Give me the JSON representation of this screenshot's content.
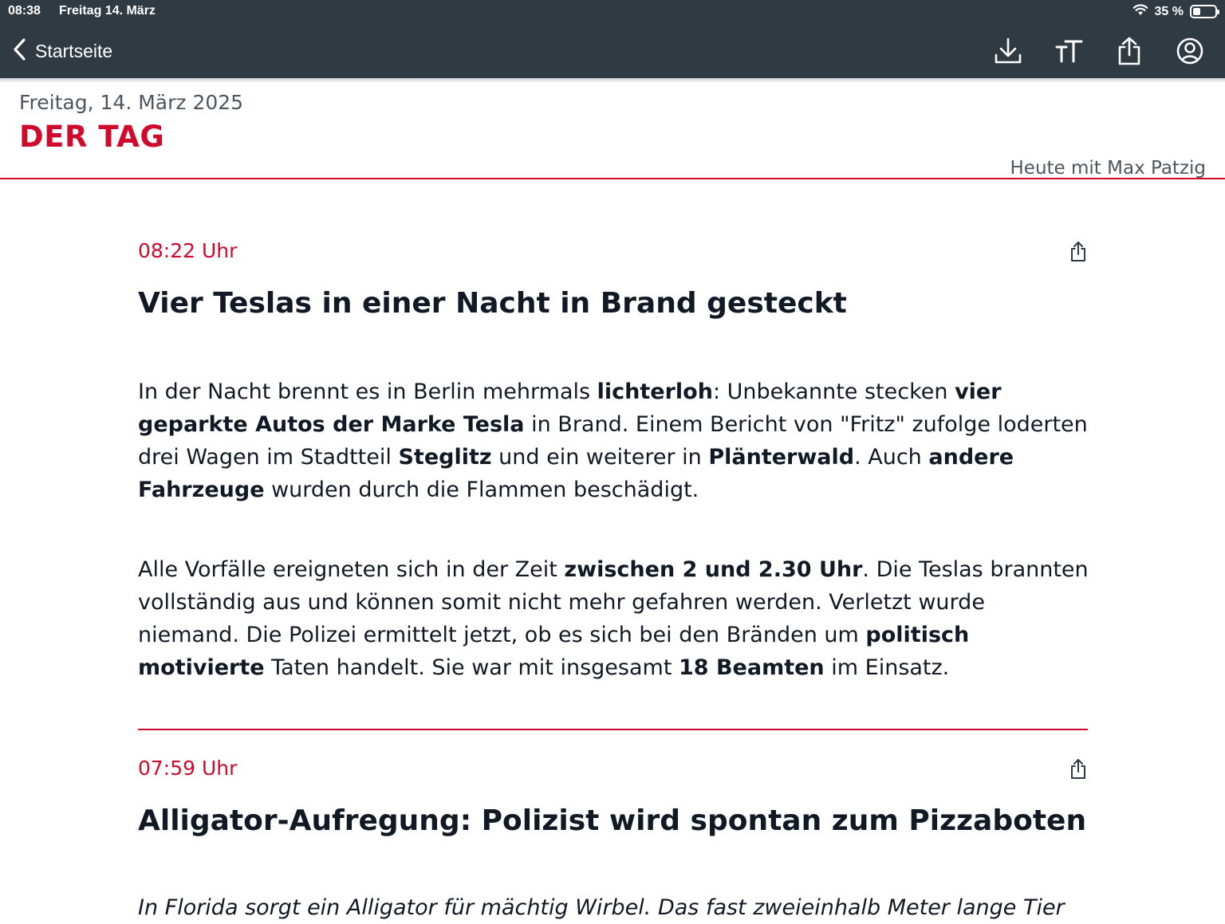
{
  "status": {
    "time": "08:38",
    "date": "Freitag 14. März",
    "battery": "35 %",
    "battery_level": 0.35
  },
  "nav": {
    "back_label": "Startseite",
    "icons": [
      "download-icon",
      "text-size-icon",
      "share-icon",
      "account-icon"
    ]
  },
  "header": {
    "date": "Freitag, 14. März 2025",
    "title": "DER TAG",
    "author": "Heute mit Max Patzig"
  },
  "articles": [
    {
      "time": "08:22 Uhr",
      "title": "Vier Teslas in einer Nacht in Brand gesteckt",
      "paragraphs": [
        [
          {
            "t": "In der Nacht brennt es in Berlin mehrmals "
          },
          {
            "t": "lichterloh",
            "b": true
          },
          {
            "t": ": Unbekannte stecken "
          },
          {
            "t": "vier geparkte Autos der Marke Tesla",
            "b": true
          },
          {
            "t": " in Brand. Einem Bericht von \"Fritz\" zufolge loderten drei Wagen im Stadtteil "
          },
          {
            "t": "Steglitz",
            "b": true
          },
          {
            "t": " und ein weiterer in "
          },
          {
            "t": "Plänterwald",
            "b": true
          },
          {
            "t": ". Auch "
          },
          {
            "t": "andere Fahrzeuge",
            "b": true
          },
          {
            "t": " wurden durch die Flammen beschädigt."
          }
        ],
        [
          {
            "t": "Alle Vorfälle ereigneten sich in der Zeit "
          },
          {
            "t": "zwischen 2 und 2.30 Uhr",
            "b": true
          },
          {
            "t": ". Die Teslas brannten vollständig aus und können somit nicht mehr gefahren werden. Verletzt wurde niemand. Die Polizei ermittelt jetzt, ob es sich bei den Bränden um "
          },
          {
            "t": "politisch motivierte",
            "b": true
          },
          {
            "t": " Taten handelt. Sie war mit insgesamt "
          },
          {
            "t": "18 Beamten",
            "b": true
          },
          {
            "t": " im Einsatz."
          }
        ]
      ]
    },
    {
      "time": "07:59 Uhr",
      "title": "Alligator-Aufregung: Polizist wird spontan zum Pizzaboten",
      "paragraphs": [
        [
          {
            "t": "In Florida sorgt ein Alligator für mächtig Wirbel. Das fast zweieinhalb Meter lange Tier"
          }
        ]
      ]
    }
  ]
}
